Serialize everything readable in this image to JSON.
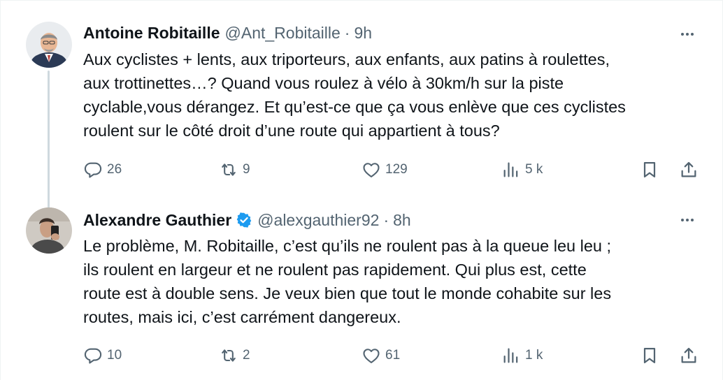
{
  "tweets": [
    {
      "author": {
        "name": "Antoine Robitaille",
        "handle": "@Ant_Robitaille",
        "verified": false,
        "avatar": "avatar-photo"
      },
      "separator": "·",
      "time": "9h",
      "text": "Aux cyclistes + lents, aux triporteurs, aux enfants, aux patins à roulettes,\naux trottinettes…? Quand vous roulez à vélo à 30km/h sur la piste\ncyclable,vous dérangez. Et qu’est-ce que ça vous enlève que ces cyclistes\nroulent sur le côté droit d’une route qui appartient à tous?",
      "stats": {
        "replies": "26",
        "reposts": "9",
        "likes": "129",
        "views": "5 k"
      }
    },
    {
      "author": {
        "name": "Alexandre Gauthier",
        "handle": "@alexgauthier92",
        "verified": true,
        "avatar": "avatar-photo"
      },
      "separator": "·",
      "time": "8h",
      "text": "Le problème, M. Robitaille, c’est qu’ils ne roulent pas à la queue leu leu ;\nils roulent en largeur et ne roulent pas rapidement. Qui plus est, cette\nroute est à double sens. Je veux bien que tout le monde cohabite sur les\nroutes, mais ici, c’est carrément dangereux.",
      "stats": {
        "replies": "10",
        "reposts": "2",
        "likes": "61",
        "views": "1 k"
      }
    }
  ],
  "icons": {
    "reply": "reply-icon",
    "repost": "repost-icon",
    "like": "like-icon",
    "views": "views-icon",
    "bookmark": "bookmark-icon",
    "share": "share-icon",
    "more": "more-icon",
    "verified": "verified-badge-icon"
  },
  "colors": {
    "text": "#0f1419",
    "secondary": "#536471",
    "verified": "#1d9bf0",
    "thread_line": "#cfd9de"
  }
}
